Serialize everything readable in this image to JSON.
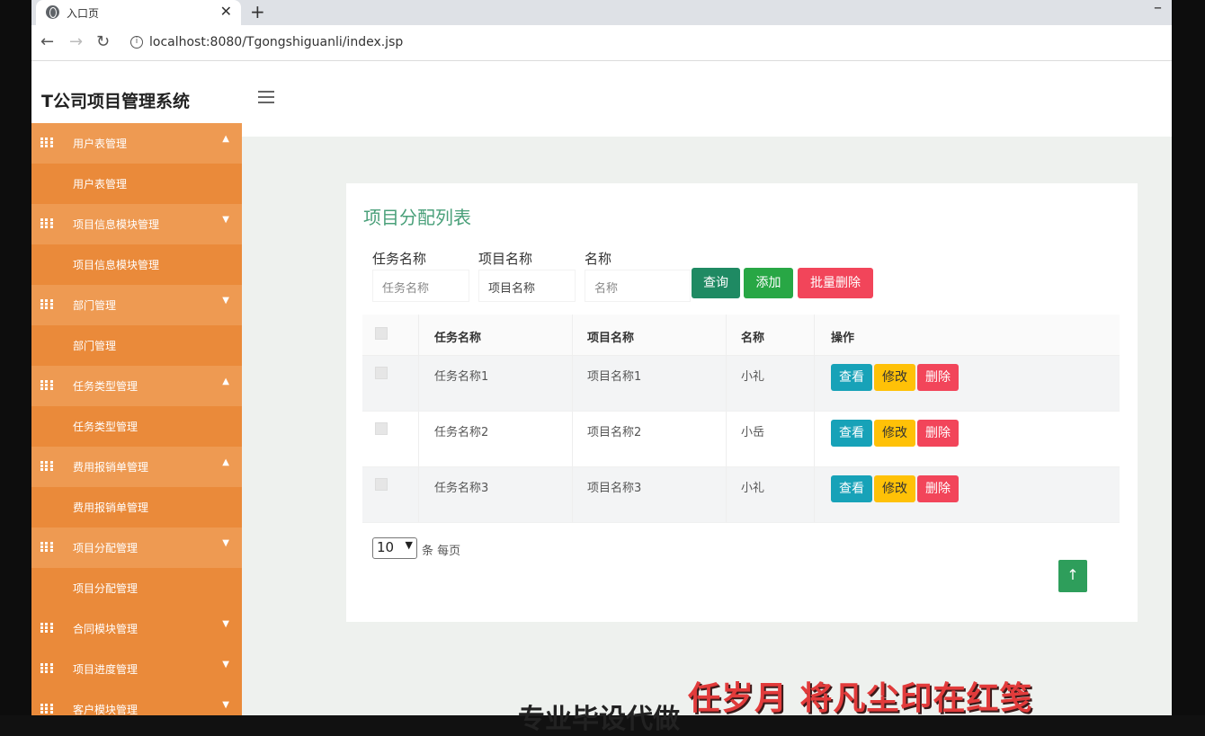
{
  "browser": {
    "tab_title": "入口页",
    "url": "localhost:8080/Tgongshiguanli/index.jsp"
  },
  "header": {
    "app_title": "T公司项目管理系统"
  },
  "sidebar": {
    "items": [
      {
        "group": "用户表管理",
        "sub": "用户表管理",
        "arrow": "▲"
      },
      {
        "group": "项目信息模块管理",
        "sub": "项目信息模块管理",
        "arrow": "▼"
      },
      {
        "group": "部门管理",
        "sub": "部门管理",
        "arrow": "▼"
      },
      {
        "group": "任务类型管理",
        "sub": "任务类型管理",
        "arrow": "▲"
      },
      {
        "group": "费用报销单管理",
        "sub": "费用报销单管理",
        "arrow": "▲"
      },
      {
        "group": "项目分配管理",
        "sub": "项目分配管理",
        "arrow": "▼"
      },
      {
        "group": "合同模块管理",
        "arrow": "▼"
      },
      {
        "group": "项目进度管理",
        "arrow": "▼"
      },
      {
        "group": "客户模块管理",
        "arrow": "▼"
      }
    ]
  },
  "main": {
    "card_title": "项目分配列表",
    "filters": [
      {
        "label": "任务名称",
        "placeholder": "任务名称"
      },
      {
        "label": "项目名称",
        "placeholder": "项目名称"
      },
      {
        "label": "名称",
        "placeholder": "名称"
      }
    ],
    "buttons": {
      "search": "查询",
      "add": "添加",
      "batch_delete": "批量删除"
    },
    "colors": {
      "search": "#1f8a63",
      "add": "#28a745",
      "batch_delete": "#f2455a",
      "view": "#17a2b8",
      "edit": "#ffc107",
      "delete": "#f2455a"
    },
    "table": {
      "headers": [
        "任务名称",
        "项目名称",
        "名称",
        "操作"
      ],
      "rows": [
        {
          "task": "任务名称1",
          "project": "项目名称1",
          "name": "小礼"
        },
        {
          "task": "任务名称2",
          "project": "项目名称2",
          "name": "小岳"
        },
        {
          "task": "任务名称3",
          "project": "项目名称3",
          "name": "小礼"
        }
      ],
      "actions": {
        "view": "查看",
        "edit": "修改",
        "delete": "删除"
      }
    },
    "pagination": {
      "page_size": "10",
      "per_page_text": "条 每页"
    },
    "to_top": "↑"
  },
  "overlay": {
    "subtitle_red": "任岁月 将凡尘印在红笺",
    "subtitle_dark": "专业毕设代做"
  }
}
